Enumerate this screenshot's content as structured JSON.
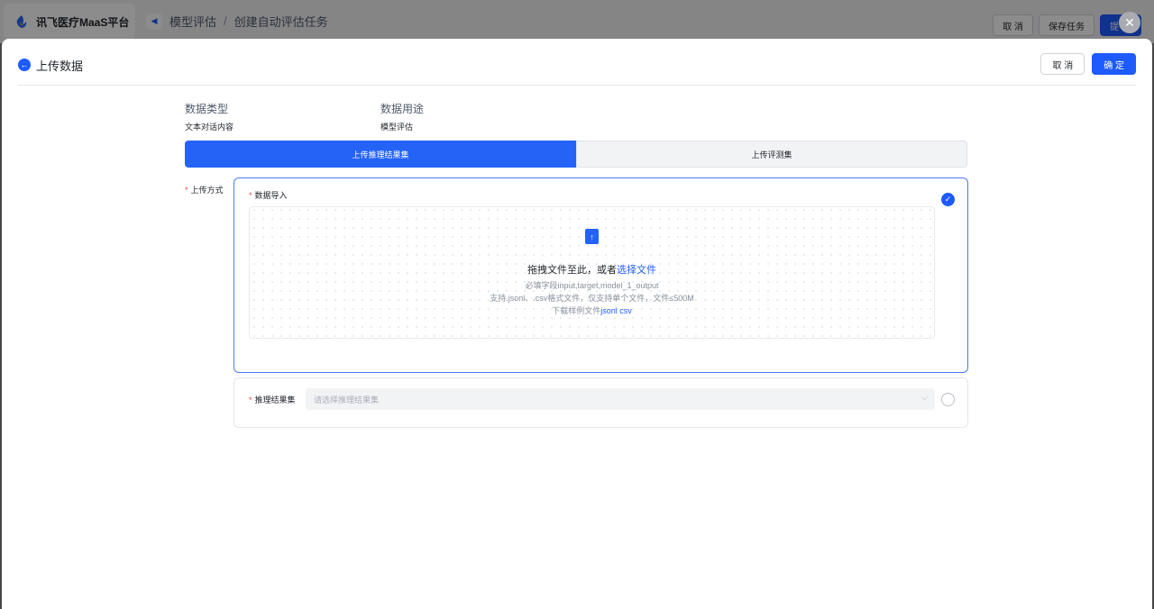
{
  "app": {
    "brand_name": "讯飞医疗MaaS平台",
    "breadcrumb": [
      "模型评估",
      "创建自动评估任务"
    ],
    "breadcrumb_sep": "/",
    "top_buttons": {
      "cancel": "取 消",
      "save": "保存任务",
      "submit": "提"
    }
  },
  "drawer": {
    "title": "上传数据",
    "cancel_label": "取 消",
    "confirm_label": "确 定",
    "meta": [
      {
        "label": "数据类型",
        "value": "文本对话内容"
      },
      {
        "label": "数据用途",
        "value": "模型评估"
      }
    ],
    "tabs": [
      {
        "label": "上传推理结果集",
        "active": true
      },
      {
        "label": "上传评测集",
        "active": false
      }
    ],
    "upload_method_label": "上传方式",
    "import": {
      "label": "数据导入",
      "drop_text": "拖拽文件至此，或者",
      "select_link": "选择文件",
      "required_fields": "必填字段input,target,model_1_output",
      "format_hint": "支持.jsonl、.csv格式文件，仅支持单个文件，文件≤500M",
      "download_prefix": "下载样例文件",
      "sample_jsonl": "jsonl",
      "sample_csv": "csv"
    },
    "result_set": {
      "label": "推理结果集",
      "placeholder": "请选择推理结果集"
    }
  },
  "colors": {
    "primary": "#1d5bff",
    "required": "#f53f3f"
  }
}
